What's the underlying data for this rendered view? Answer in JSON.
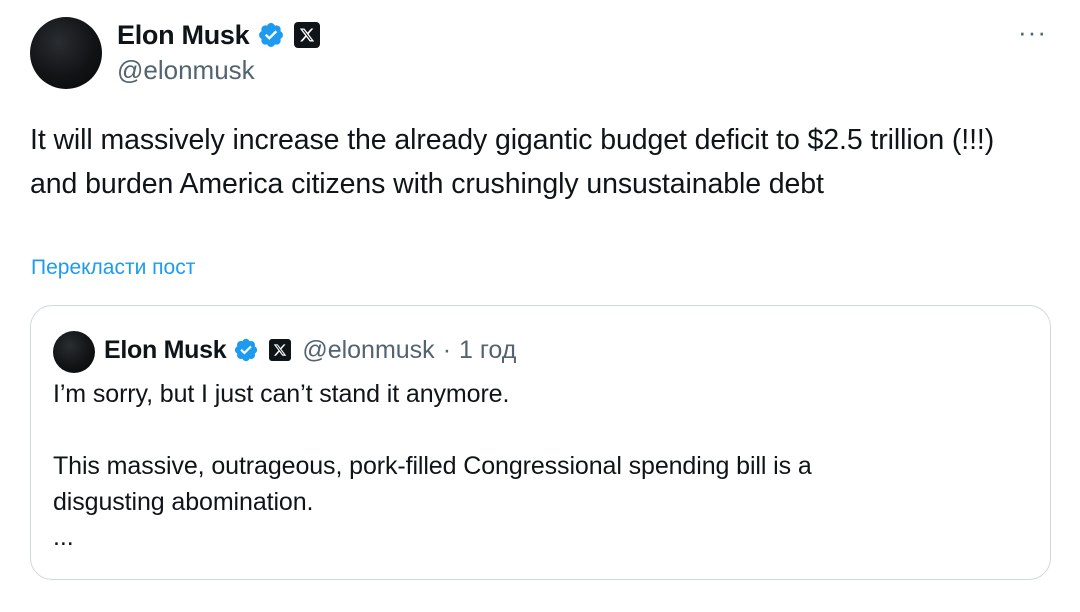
{
  "author": {
    "display_name": "Elon Musk",
    "handle": "@elonmusk",
    "verified_icon": "verified-badge-icon",
    "affiliate_icon": "x-logo-icon",
    "accent_color": "#1d9bf0"
  },
  "menu": {
    "more_label": "···"
  },
  "post": {
    "text": "It will massively increase the already gigantic budget deficit to $2.5 trillion (!!!) and burden America citizens with crushingly unsustainable debt",
    "translate_label": "Перекласти пост"
  },
  "quoted_post": {
    "display_name": "Elon Musk",
    "handle": "@elonmusk",
    "separator": "·",
    "time": "1 год",
    "lines": [
      "I’m sorry, but I just can’t stand it anymore.",
      "",
      "This massive, outrageous, pork-filled Congressional spending bill is a",
      "disgusting abomination."
    ],
    "ellipsis": "..."
  }
}
